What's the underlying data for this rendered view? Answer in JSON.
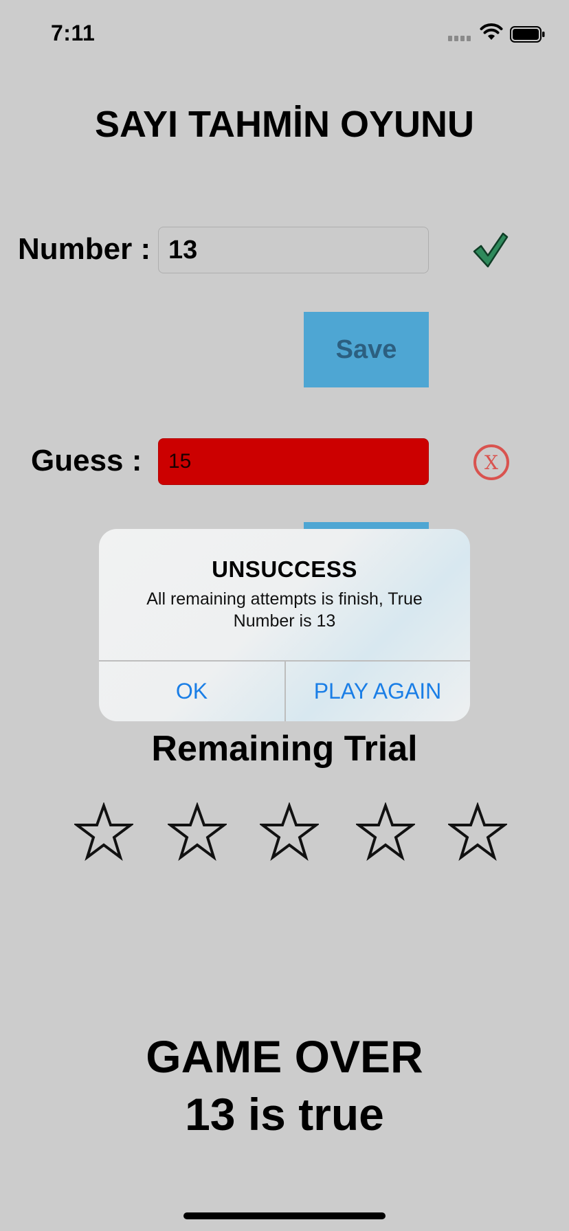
{
  "status_bar": {
    "time": "7:11"
  },
  "title": "SAYI TAHMİN OYUNU",
  "number_row": {
    "label": "Number :",
    "value": "13",
    "status_icon": "checkmark-icon"
  },
  "save_button": {
    "label": "Save"
  },
  "guess_row": {
    "label": "Guess :",
    "value": "15",
    "status_icon": "x-circle-icon"
  },
  "alert": {
    "title": "UNSUCCESS",
    "message": "All remaining attempts is finish, True Number is 13",
    "buttons": [
      {
        "label": "OK"
      },
      {
        "label": "PLAY AGAIN"
      }
    ]
  },
  "remaining": {
    "label": "Remaining Trial",
    "stars_total": 5,
    "stars_filled": 0
  },
  "result": {
    "line1": "GAME OVER",
    "line2": "13 is true"
  },
  "colors": {
    "background": "#cccccc",
    "button": "#4ea6d3",
    "error_field": "#cc0000",
    "success_icon": "#2f8a5c",
    "error_icon": "#d9534f",
    "alert_button_text": "#1a7ee6"
  }
}
